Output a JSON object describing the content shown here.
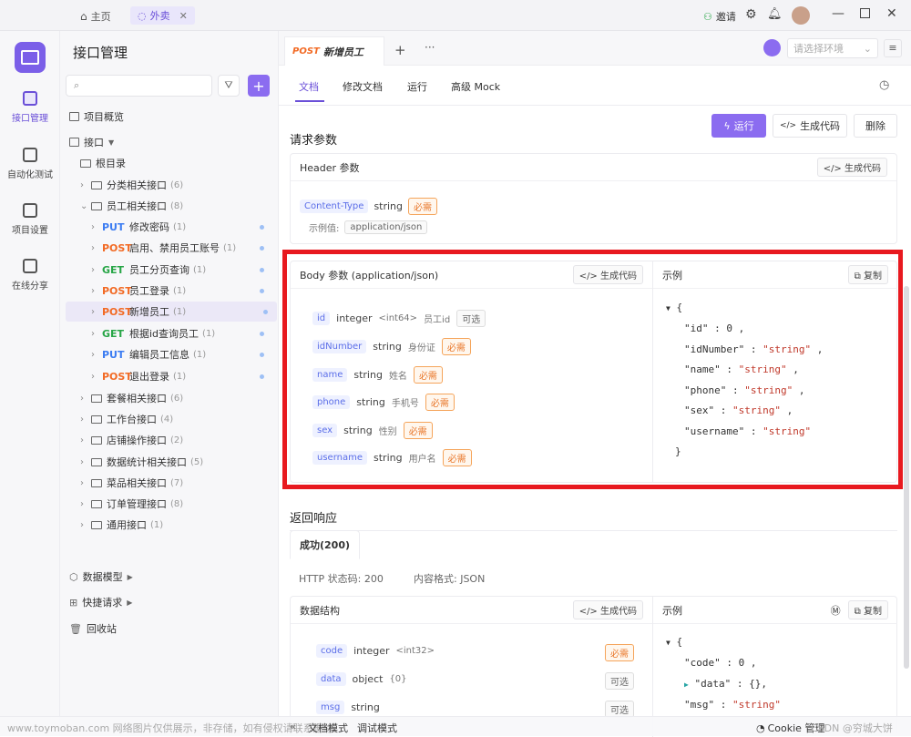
{
  "titlebar": {
    "home_tab": "主页",
    "active_tab": "外卖",
    "invite": "邀请"
  },
  "leftnav": [
    {
      "label": "接口管理"
    },
    {
      "label": "自动化测试"
    },
    {
      "label": "项目设置"
    },
    {
      "label": "在线分享"
    }
  ],
  "tree": {
    "title": "接口管理",
    "overview": "项目概览",
    "api_root": "接口",
    "root_folder": "根目录",
    "folders_top": [
      {
        "name": "分类相关接口",
        "count": "(6)"
      },
      {
        "name": "员工相关接口",
        "count": "(8)"
      }
    ],
    "endpoints": [
      {
        "method": "PUT",
        "name": "修改密码",
        "count": "(1)"
      },
      {
        "method": "POST",
        "name": "启用、禁用员工账号",
        "count": "(1)"
      },
      {
        "method": "GET",
        "name": "员工分页查询",
        "count": "(1)"
      },
      {
        "method": "POST",
        "name": "员工登录",
        "count": "(1)"
      },
      {
        "method": "POST",
        "name": "新增员工",
        "count": "(1)"
      },
      {
        "method": "GET",
        "name": "根据id查询员工",
        "count": "(1)"
      },
      {
        "method": "PUT",
        "name": "编辑员工信息",
        "count": "(1)"
      },
      {
        "method": "POST",
        "name": "退出登录",
        "count": "(1)"
      }
    ],
    "folders_bottom": [
      {
        "name": "套餐相关接口",
        "count": "(6)"
      },
      {
        "name": "工作台接口",
        "count": "(4)"
      },
      {
        "name": "店铺操作接口",
        "count": "(2)"
      },
      {
        "name": "数据统计相关接口",
        "count": "(5)"
      },
      {
        "name": "菜品相关接口",
        "count": "(7)"
      },
      {
        "name": "订单管理接口",
        "count": "(8)"
      },
      {
        "name": "通用接口",
        "count": "(1)"
      }
    ],
    "data_model": "数据模型",
    "quick_request": "快捷请求",
    "trash": "回收站"
  },
  "doc": {
    "tab_method": "POST",
    "tab_title": "新增员工",
    "env_placeholder": "请选择环境",
    "subtabs": [
      "文档",
      "修改文档",
      "运行",
      "高级 Mock"
    ],
    "run": "运行",
    "gen_code": "生成代码",
    "delete": "删除",
    "req_params": "请求参数",
    "header_title": "Header 参数",
    "header_gen": "生成代码",
    "header_field": "Content-Type",
    "header_type": "string",
    "required": "必需",
    "optional": "可选",
    "example_label": "示例值:",
    "example_value": "application/json",
    "body_title": "Body 参数 (application/json)",
    "body_gen": "生成代码",
    "example_title": "示例",
    "copy": "复制",
    "body_fields": [
      {
        "name": "id",
        "type": "integer",
        "fmt": "<int64>",
        "desc": "员工id",
        "flag": "可选"
      },
      {
        "name": "idNumber",
        "type": "string",
        "fmt": "",
        "desc": "身份证",
        "flag": "必需"
      },
      {
        "name": "name",
        "type": "string",
        "fmt": "",
        "desc": "姓名",
        "flag": "必需"
      },
      {
        "name": "phone",
        "type": "string",
        "fmt": "",
        "desc": "手机号",
        "flag": "必需"
      },
      {
        "name": "sex",
        "type": "string",
        "fmt": "",
        "desc": "性别",
        "flag": "必需"
      },
      {
        "name": "username",
        "type": "string",
        "fmt": "",
        "desc": "用户名",
        "flag": "必需"
      }
    ],
    "json_lines": [
      {
        "key": "\"id\"",
        "val": "0",
        "str": false
      },
      {
        "key": "\"idNumber\"",
        "val": "\"string\"",
        "str": true
      },
      {
        "key": "\"name\"",
        "val": "\"string\"",
        "str": true
      },
      {
        "key": "\"phone\"",
        "val": "\"string\"",
        "str": true
      },
      {
        "key": "\"sex\"",
        "val": "\"string\"",
        "str": true
      },
      {
        "key": "\"username\"",
        "val": "\"string\"",
        "str": true
      }
    ],
    "resp_title": "返回响应",
    "resp_tab": "成功(200)",
    "http_status": "HTTP 状态码: 200",
    "content_type": "内容格式: JSON",
    "data_struct": "数据结构",
    "resp_fields": [
      {
        "name": "code",
        "type": "integer",
        "fmt": "<int32>",
        "flag": "必需"
      },
      {
        "name": "data",
        "type": "object",
        "fmt": "{0}",
        "flag": "可选"
      },
      {
        "name": "msg",
        "type": "string",
        "fmt": "",
        "flag": "可选"
      }
    ],
    "resp_json": [
      {
        "key": "\"code\"",
        "val": "0",
        "str": false
      },
      {
        "key": "\"data\"",
        "val": "{},",
        "str": false
      },
      {
        "key": "\"msg\"",
        "val": "\"string\"",
        "str": true
      }
    ]
  },
  "bottombar": {
    "doc_mode": "文档模式",
    "debug_mode": "调试模式",
    "cookie": "Cookie 管理",
    "watermark": "www.toymoban.com 网络图片仅供展示，非存储，如有侵权请联系删除。",
    "credit": "CSDN @穷城大饼"
  },
  "colors": {
    "accent": "#8b6cf0",
    "highlight": "#e8191f"
  }
}
